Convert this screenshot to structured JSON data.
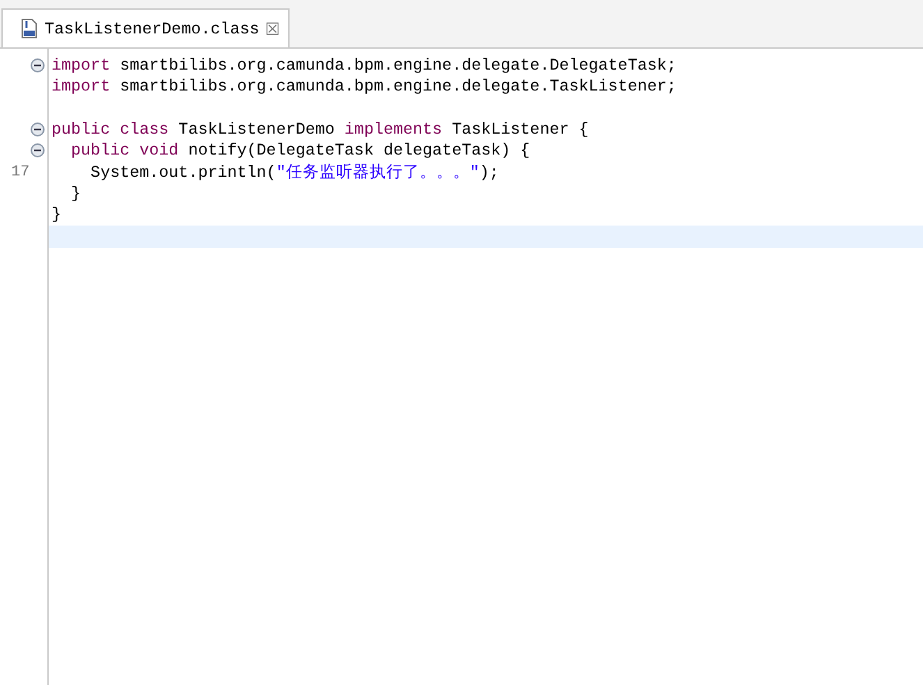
{
  "tabs": [
    {
      "label": "TaskListenerDemo.class",
      "selected": true,
      "close": "☒"
    }
  ],
  "editor": {
    "lines": [
      {
        "fold": true,
        "tokens": [
          {
            "kind": "keyword",
            "text": "import"
          },
          {
            "kind": "plain",
            "text": " smartbilibs.org.camunda.bpm.engine.delegate.DelegateTask;"
          }
        ]
      },
      {
        "tokens": [
          {
            "kind": "keyword",
            "text": "import"
          },
          {
            "kind": "plain",
            "text": " smartbilibs.org.camunda.bpm.engine.delegate.TaskListener;"
          }
        ]
      },
      {
        "blank_before": true,
        "fold": true,
        "tokens": [
          {
            "kind": "keyword",
            "text": "public class"
          },
          {
            "kind": "plain",
            "text": " TaskListenerDemo "
          },
          {
            "kind": "keyword",
            "text": "implements"
          },
          {
            "kind": "plain",
            "text": " TaskListener {"
          }
        ]
      },
      {
        "fold": true,
        "tokens": [
          {
            "kind": "keyword",
            "text": "  public void"
          },
          {
            "kind": "plain",
            "text": " notify(DelegateTask delegateTask) {"
          }
        ]
      },
      {
        "number": "17",
        "tokens": [
          {
            "kind": "plain",
            "text": "    System.out.println("
          },
          {
            "kind": "string",
            "text": "\"任务监听器执行了。。。\""
          },
          {
            "kind": "plain",
            "text": ");"
          }
        ]
      },
      {
        "tokens": [
          {
            "kind": "plain",
            "text": "  }"
          }
        ]
      },
      {
        "tokens": [
          {
            "kind": "plain",
            "text": "}"
          }
        ]
      },
      {
        "current": true
      }
    ]
  }
}
